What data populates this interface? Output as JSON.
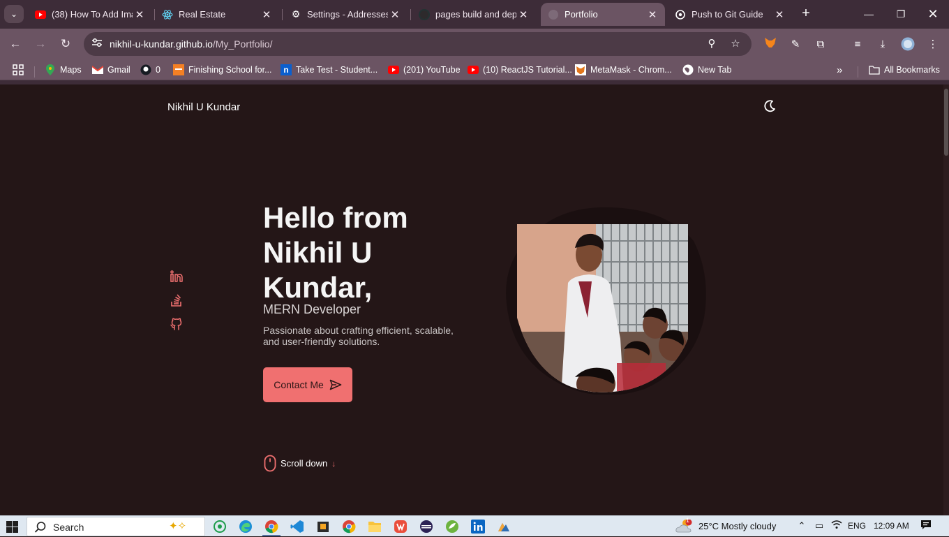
{
  "browser": {
    "tabs": [
      {
        "title": "(38) How To Add Ima",
        "icon": "youtube-icon"
      },
      {
        "title": "Real Estate",
        "icon": "react-icon"
      },
      {
        "title": "Settings - Addresses",
        "icon": "gear-icon"
      },
      {
        "title": "pages build and depl",
        "icon": "github-icon"
      },
      {
        "title": "Portfolio",
        "icon": "globe-icon",
        "active": true
      },
      {
        "title": "Push to Git Guide",
        "icon": "chatgpt-icon"
      }
    ],
    "url_host": "nikhil-u-kundar.github.io",
    "url_path": "/My_Portfolio/",
    "bookmarks": [
      {
        "label": "Maps",
        "icon": "maps-icon"
      },
      {
        "label": "Gmail",
        "icon": "gmail-icon"
      },
      {
        "label": "0",
        "icon": "github-icon"
      },
      {
        "label": "Finishing School for...",
        "icon": "school-icon"
      },
      {
        "label": "Take Test - Student...",
        "icon": "n-icon"
      },
      {
        "label": "(201) YouTube",
        "icon": "youtube-icon"
      },
      {
        "label": "(10) ReactJS Tutorial...",
        "icon": "youtube-icon"
      },
      {
        "label": "MetaMask - Chrom...",
        "icon": "metamask-icon"
      },
      {
        "label": "New Tab",
        "icon": "globe-icon"
      }
    ],
    "all_bookmarks": "All Bookmarks"
  },
  "site": {
    "name": "Nikhil U Kundar",
    "hero_title": "Hello from Nikhil U Kundar,",
    "hero_subtitle": "MERN Developer",
    "hero_description": "Passionate about crafting efficient, scalable, and user-friendly solutions.",
    "contact_label": "Contact Me",
    "scroll_label": "Scroll down",
    "socials": [
      "linkedin-icon",
      "stackoverflow-icon",
      "github-icon"
    ],
    "accent": "#f07070",
    "background": "#241617"
  },
  "taskbar": {
    "search_placeholder": "Search",
    "weather": "25°C  Mostly cloudy",
    "weather_badge": "1",
    "language": "ENG",
    "time": "12:09 AM"
  }
}
